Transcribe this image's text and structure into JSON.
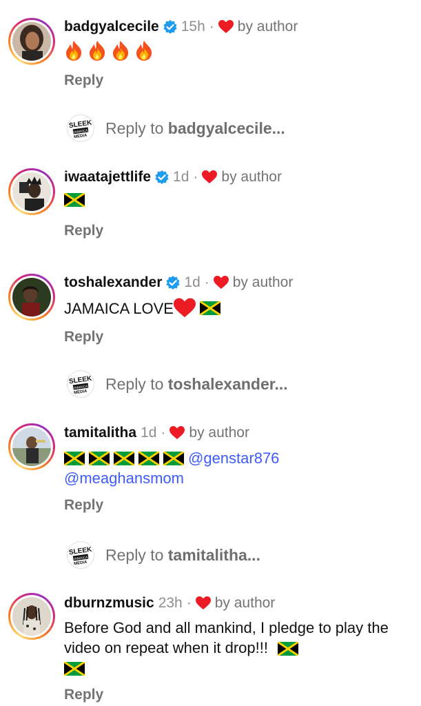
{
  "colors": {
    "verified": "#1d9bf0",
    "heart": "#ed1c24",
    "mention": "#3d5afe",
    "muted": "#737373"
  },
  "comments": [
    {
      "username": "badgyalcecile",
      "verified": true,
      "time": "15h",
      "liked_by": "by author",
      "body_emoji": [
        "fire",
        "fire",
        "fire",
        "fire"
      ],
      "reply_label": "Reply",
      "reply_to": {
        "prefix": "Reply to ",
        "name": "badgyalcecile..."
      }
    },
    {
      "username": "iwaatajettlife",
      "verified": true,
      "time": "1d",
      "liked_by": "by author",
      "body_emoji": [
        "jamaica-flag"
      ],
      "reply_label": "Reply"
    },
    {
      "username": "toshalexander",
      "verified": true,
      "time": "1d",
      "liked_by": "by author",
      "body_text": "JAMAICA LOVE",
      "body_emoji": [
        "red-heart",
        "jamaica-flag"
      ],
      "reply_label": "Reply",
      "reply_to": {
        "prefix": "Reply to ",
        "name": "toshalexander..."
      }
    },
    {
      "username": "tamitalitha",
      "verified": false,
      "time": "1d",
      "liked_by": "by author",
      "body_emoji": [
        "jamaica-flag",
        "jamaica-flag",
        "jamaica-flag",
        "jamaica-flag",
        "jamaica-flag"
      ],
      "mentions": [
        "@genstar876",
        "@meaghansmom"
      ],
      "reply_label": "Reply",
      "reply_to": {
        "prefix": "Reply to ",
        "name": "tamitalitha..."
      }
    },
    {
      "username": "dburnzmusic",
      "verified": false,
      "time": "23h",
      "liked_by": "by author",
      "body_text": "Before God and all mankind, I pledge to play the video on repeat when it drop!!!",
      "body_emoji": [
        "jamaica-flag",
        "jamaica-flag"
      ],
      "reply_label": "Reply"
    }
  ],
  "reply_avatar_logo": "SLEEK JAMAICA MEDIA",
  "time_separator": "·"
}
